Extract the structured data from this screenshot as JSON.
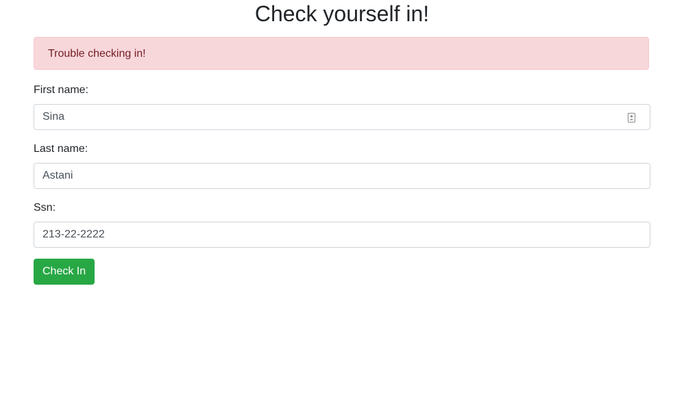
{
  "page": {
    "title": "Check yourself in!"
  },
  "alert": {
    "message": "Trouble checking in!"
  },
  "form": {
    "first_name": {
      "label": "First name:",
      "value": "Sina"
    },
    "last_name": {
      "label": "Last name:",
      "value": "Astani"
    },
    "ssn": {
      "label": "Ssn:",
      "value": "213-22-2222"
    },
    "submit_label": "Check In"
  },
  "icons": {
    "first_name_field_icon": "contact-card-icon"
  },
  "colors": {
    "alert_background": "#f8d7da",
    "alert_text": "#721c24",
    "button_background": "#28a745",
    "button_text": "#ffffff"
  }
}
